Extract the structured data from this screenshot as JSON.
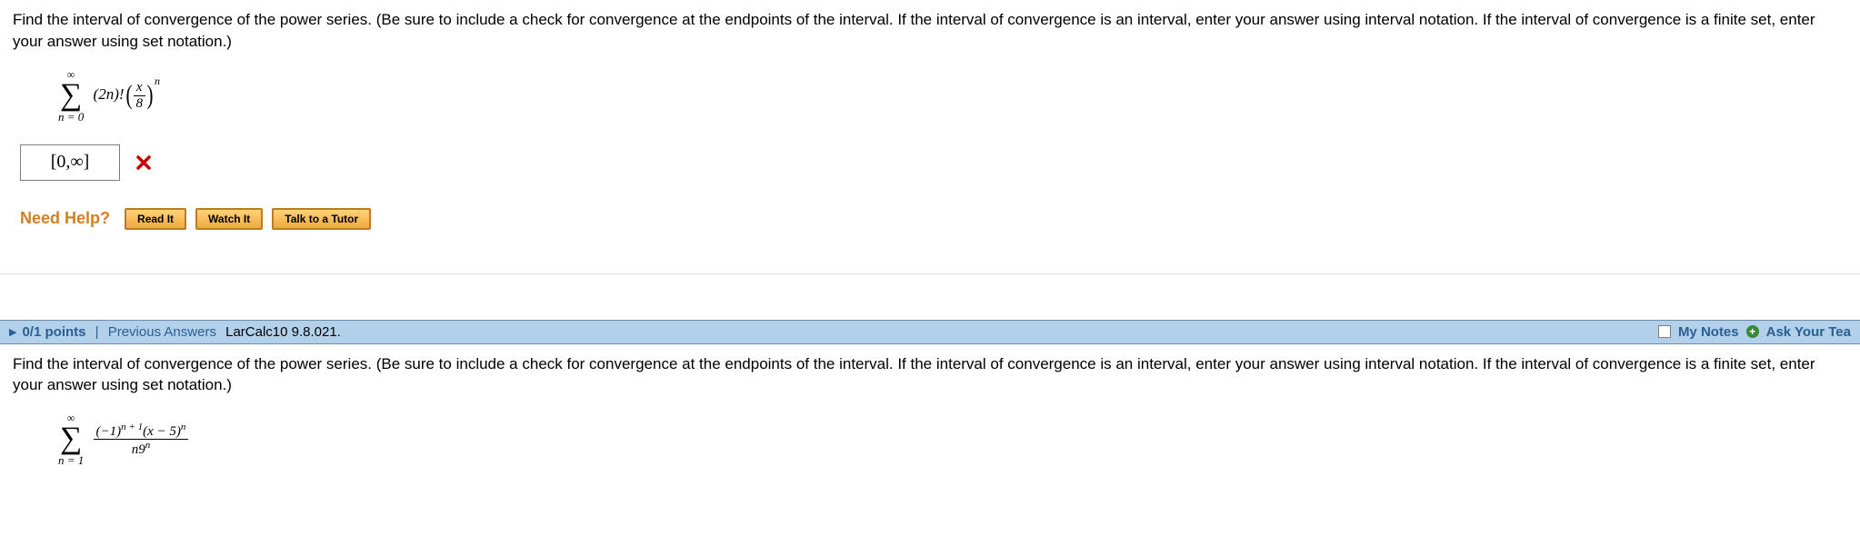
{
  "q1": {
    "prompt": "Find the interval of convergence of the power series. (Be sure to include a check for convergence at the endpoints of the interval. If the interval of convergence is an interval, enter your answer using interval notation. If the interval of convergence is a finite set, enter your answer using set notation.)",
    "sigma_upper": "∞",
    "sigma_lower": "n = 0",
    "coeff": "(2n)!",
    "frac_num": "x",
    "frac_den": "8",
    "exp": "n",
    "answer_value": "[0,∞]",
    "help_label": "Need Help?",
    "btn_read": "Read It",
    "btn_watch": "Watch It",
    "btn_tutor": "Talk to a Tutor"
  },
  "header": {
    "points": "0/1 points",
    "prev": "Previous Answers",
    "source": "LarCalc10 9.8.021.",
    "my_notes": "My Notes",
    "ask": "Ask Your Tea"
  },
  "q2": {
    "prompt": "Find the interval of convergence of the power series. (Be sure to include a check for convergence at the endpoints of the interval. If the interval of convergence is an interval, enter your answer using interval notation. If the interval of convergence is a finite set, enter your answer using set notation.)",
    "sigma_upper": "∞",
    "sigma_lower": "n = 1",
    "num_a": "(−1)",
    "num_exp": "n + 1",
    "num_b": "(x − 5)",
    "num_b_exp": "n",
    "den_base": "n9",
    "den_exp": "n"
  }
}
